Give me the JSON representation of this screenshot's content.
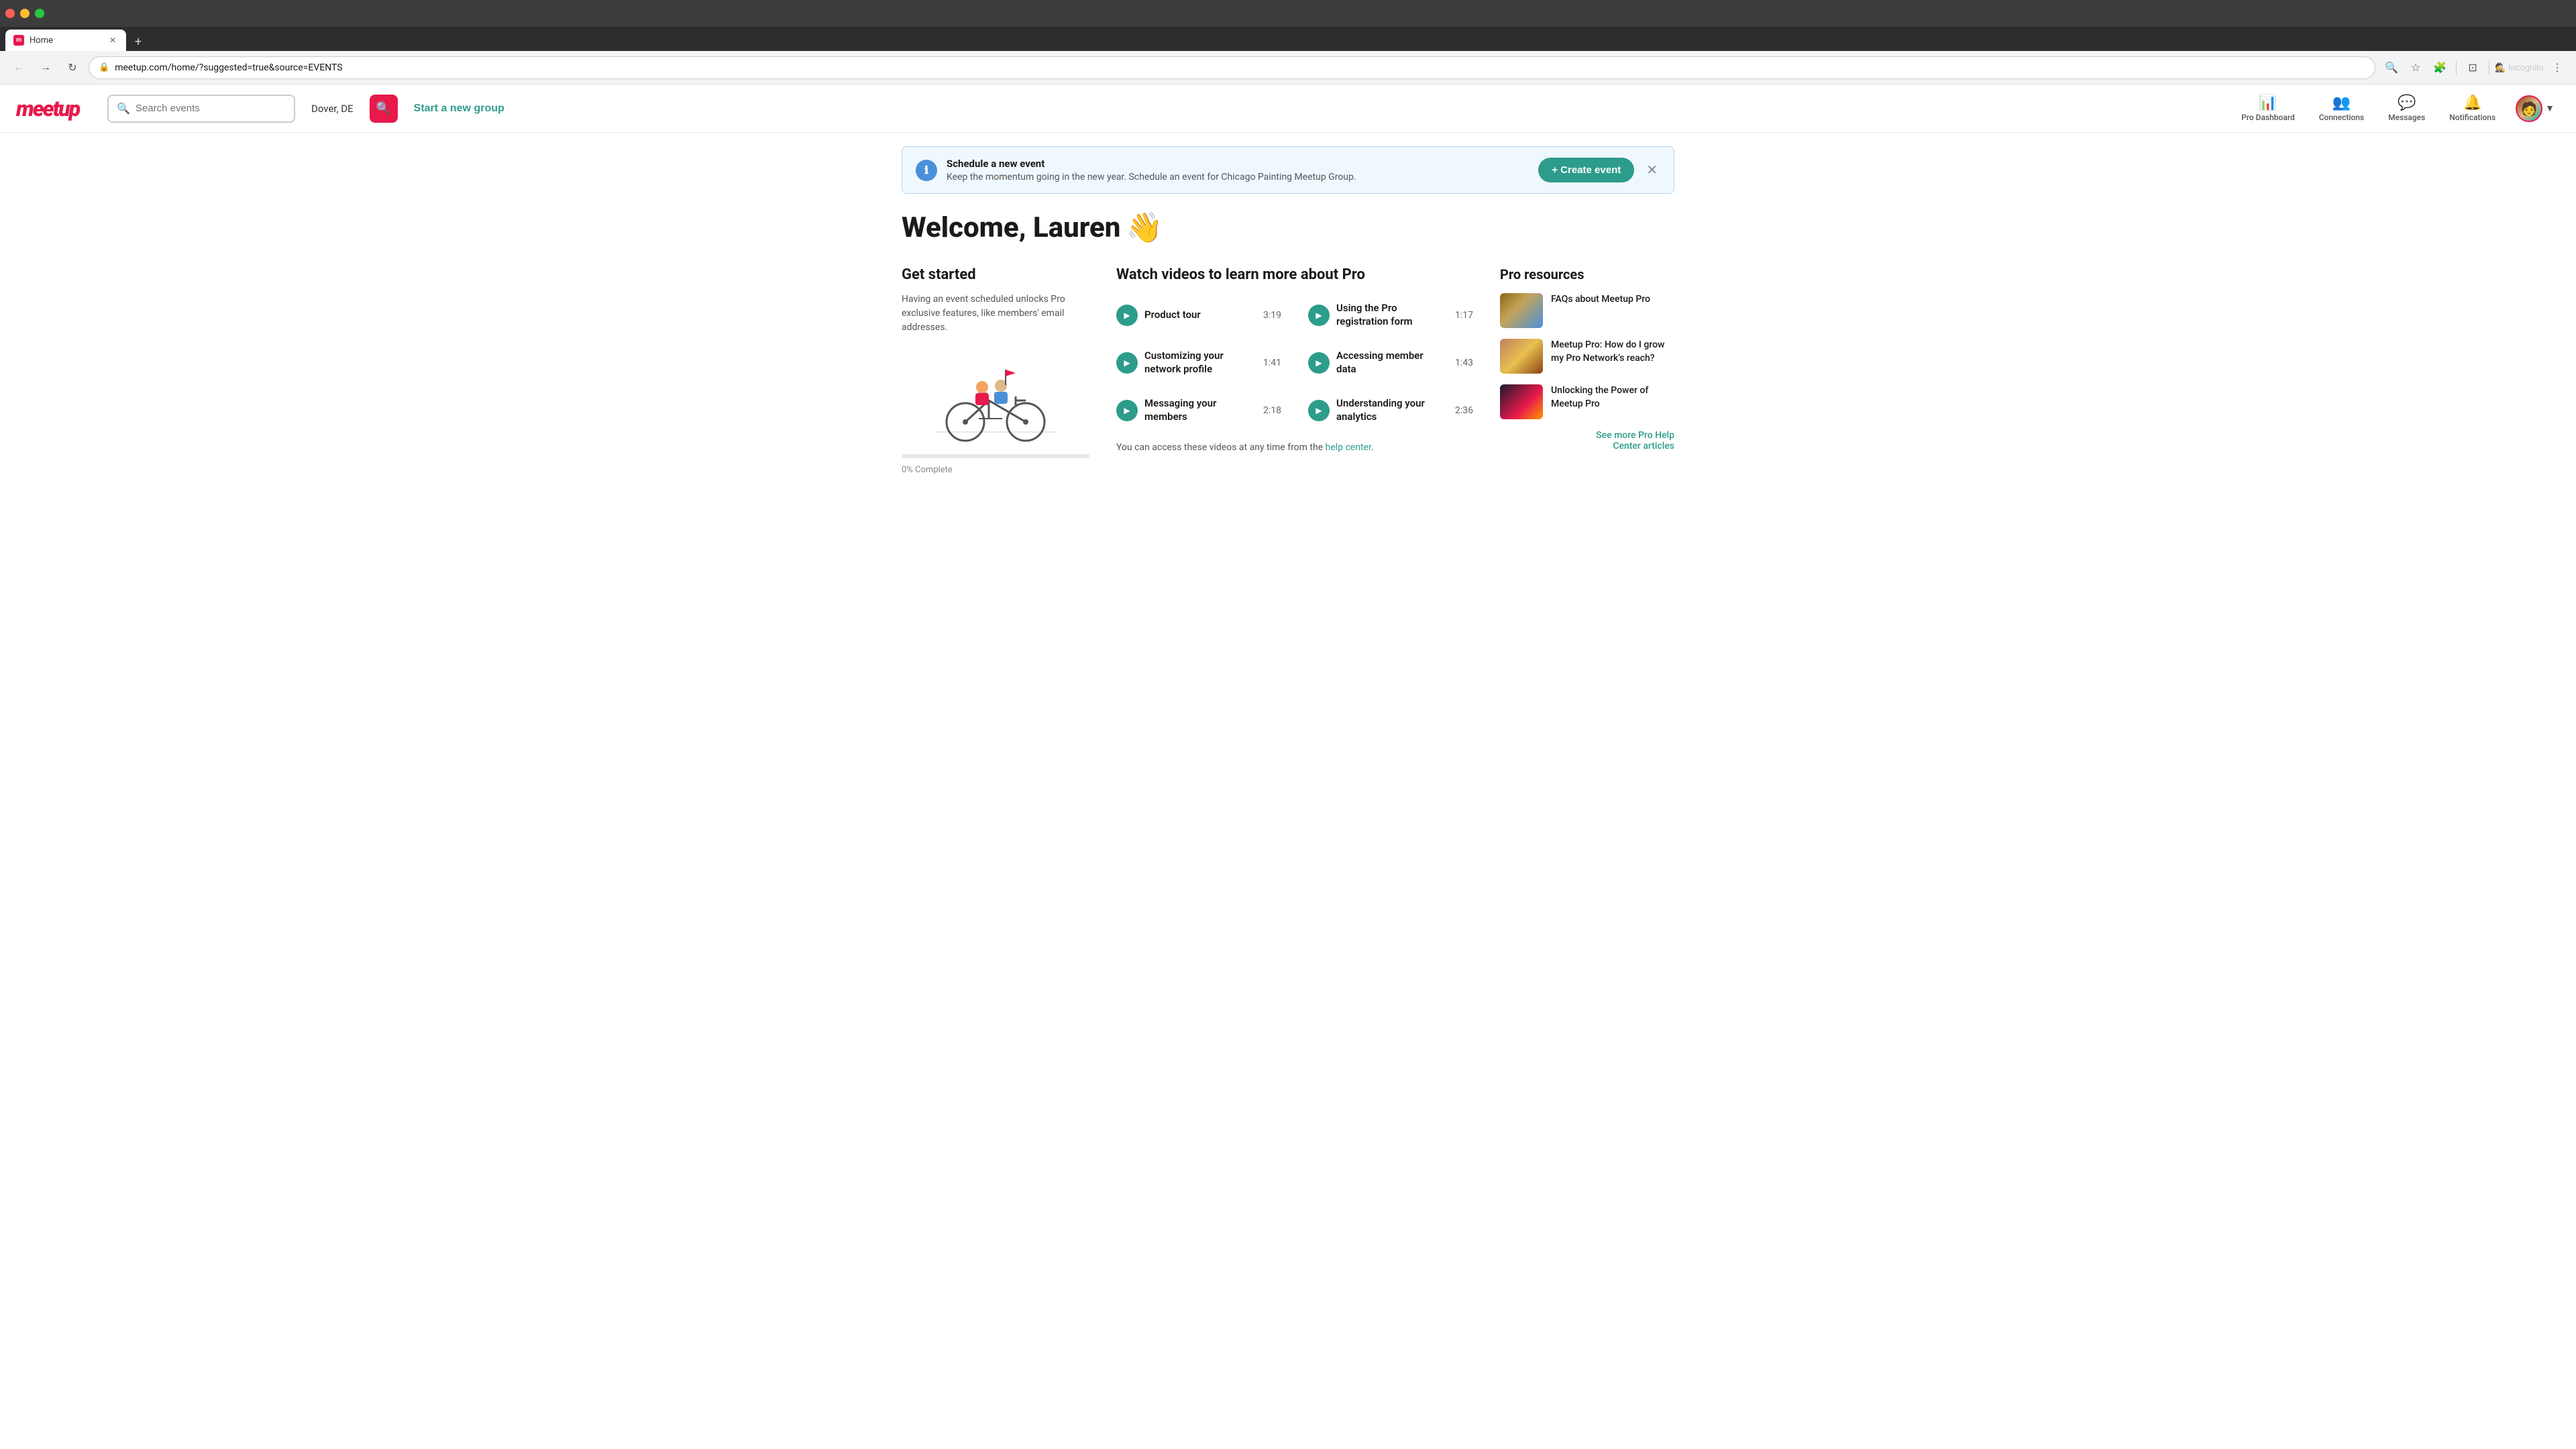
{
  "browser": {
    "tab_title": "Home",
    "address_url": "meetup.com/home/?suggested=true&source=EVENTS",
    "incognito_label": "Incognito"
  },
  "header": {
    "logo_text": "meetup",
    "search_placeholder": "Search events",
    "location_text": "Dover, DE",
    "start_group_label": "Start a new group",
    "nav": {
      "pro_dashboard_label": "Pro Dashboard",
      "connections_label": "Connections",
      "messages_label": "Messages",
      "notifications_label": "Notifications"
    }
  },
  "banner": {
    "title": "Schedule a new event",
    "subtitle": "Keep the momentum going in the new year. Schedule an event for Chicago Painting Meetup Group.",
    "cta_label": "+ Create event"
  },
  "welcome": {
    "greeting": "Welcome, Lauren",
    "emoji": "👋"
  },
  "get_started": {
    "title": "Get started",
    "description": "Having an event scheduled unlocks Pro exclusive features, like members' email addresses.",
    "progress_percent": "0",
    "progress_label": "0% Complete"
  },
  "videos": {
    "title": "Watch videos to learn more about Pro",
    "items": [
      {
        "title": "Product tour",
        "duration": "3:19"
      },
      {
        "title": "Using the Pro registration form",
        "duration": "1:17"
      },
      {
        "title": "Customizing your network profile",
        "duration": "1:41"
      },
      {
        "title": "Accessing member data",
        "duration": "1:43"
      },
      {
        "title": "Messaging your members",
        "duration": "2:18"
      },
      {
        "title": "Understanding your analytics",
        "duration": "2:36"
      }
    ],
    "footer_prefix": "You can access these videos at any time from the ",
    "help_center_label": "help center",
    "footer_suffix": "."
  },
  "pro_resources": {
    "title": "Pro resources",
    "items": [
      {
        "title": "FAQs about Meetup Pro"
      },
      {
        "title": "Meetup Pro: How do I grow my Pro Network's reach?"
      },
      {
        "title": "Unlocking the Power of Meetup Pro"
      }
    ],
    "see_more_line1": "See more Pro Help",
    "see_more_line2": "Center articles"
  }
}
